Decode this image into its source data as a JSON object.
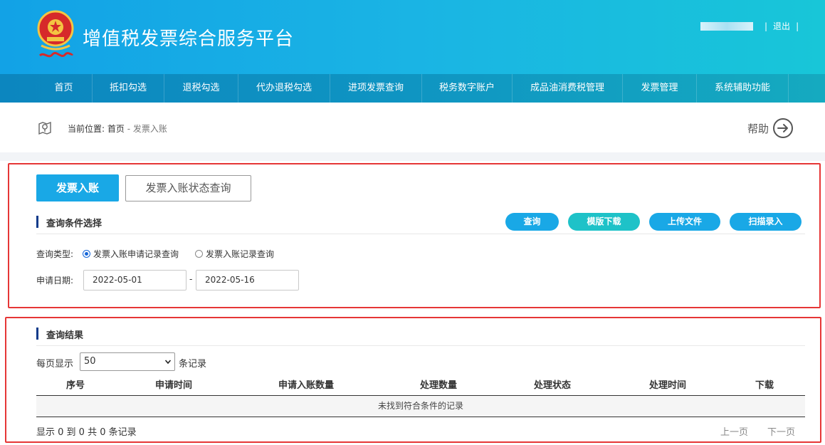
{
  "header": {
    "title": "增值税发票综合服务平台",
    "logout": "退出",
    "separator": "|"
  },
  "nav": {
    "items": [
      {
        "label": "首页",
        "width": 80
      },
      {
        "label": "抵扣勾选",
        "width": 101
      },
      {
        "label": "退税勾选",
        "width": 104
      },
      {
        "label": "代办退税勾选",
        "width": 129
      },
      {
        "label": "进项发票查询",
        "width": 129
      },
      {
        "label": "税务数字账户",
        "width": 127
      },
      {
        "label": "成品油消费税管理",
        "width": 155
      },
      {
        "label": "发票管理",
        "width": 104
      },
      {
        "label": "系统辅助功能",
        "width": 129
      }
    ]
  },
  "breadcrumb": {
    "prefix": "当前位置:",
    "home": "首页",
    "dash": " - ",
    "current": "发票入账"
  },
  "help": {
    "label": "帮助"
  },
  "tabs": {
    "active": "发票入账",
    "other": "发票入账状态查询"
  },
  "query": {
    "title": "查询条件选择",
    "buttons": [
      {
        "label": "查询",
        "color": "#19a8e6"
      },
      {
        "label": "模版下载",
        "color": "#1ec2c8"
      },
      {
        "label": "上传文件",
        "color": "#19a8e6"
      },
      {
        "label": "扫描录入",
        "color": "#19a8e6"
      }
    ],
    "type_label": "查询类型:",
    "radio_apply": "发票入账申请记录查询",
    "radio_record": "发票入账记录查询",
    "selected_radio": "发票入账申请记录查询",
    "date_label": "申请日期:",
    "date_from": "2022-05-01",
    "date_sep": "-",
    "date_to": "2022-05-16"
  },
  "results": {
    "title": "查询结果",
    "per_page_label": "每页显示",
    "per_page_value": "50",
    "per_page_suffix": "条记录",
    "columns": [
      "序号",
      "申请时间",
      "申请入账数量",
      "处理数量",
      "处理状态",
      "处理时间",
      "下载"
    ],
    "empty_text": "未找到符合条件的记录",
    "summary": "显示 0 到 0 共 0 条记录",
    "prev": "上一页",
    "next": "下一页"
  },
  "colors": {
    "header_start": "#12a2e6",
    "header_end": "#18c6d8",
    "nav_bg": "#0f95c2",
    "primary": "#19a8e6",
    "teal": "#1ec2c8",
    "highlight_border": "#e63636",
    "section_bar": "#0e3a8a"
  }
}
